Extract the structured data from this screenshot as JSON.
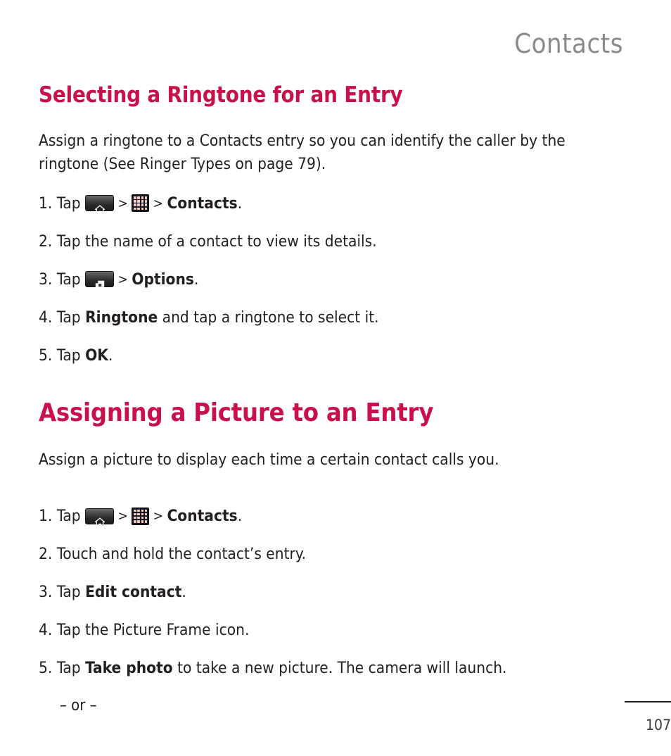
{
  "header": {
    "running_title": "Contacts"
  },
  "sections": [
    {
      "heading": "Selecting a Ringtone for an Entry",
      "intro": "Assign a ringtone to a Contacts entry so you can identify the caller by the ringtone (See Ringer Types on page 79).",
      "steps": [
        {
          "number": "1.",
          "parts": [
            {
              "type": "text",
              "text": "Tap "
            },
            {
              "type": "icon",
              "icon": "home-key-icon"
            },
            {
              "type": "text",
              "text": " > "
            },
            {
              "type": "icon",
              "icon": "app-grid-icon"
            },
            {
              "type": "text",
              "text": " > "
            },
            {
              "type": "bold",
              "text": "Contacts"
            },
            {
              "type": "text",
              "text": "."
            }
          ]
        },
        {
          "number": "2.",
          "parts": [
            {
              "type": "text",
              "text": "Tap the name of a contact to view its details."
            }
          ]
        },
        {
          "number": "3.",
          "parts": [
            {
              "type": "text",
              "text": "Tap "
            },
            {
              "type": "icon",
              "icon": "menu-key-icon"
            },
            {
              "type": "text",
              "text": " > "
            },
            {
              "type": "bold",
              "text": "Options"
            },
            {
              "type": "text",
              "text": "."
            }
          ]
        },
        {
          "number": "4.",
          "parts": [
            {
              "type": "text",
              "text": "Tap "
            },
            {
              "type": "bold",
              "text": "Ringtone"
            },
            {
              "type": "text",
              "text": " and tap a ringtone to select it."
            }
          ]
        },
        {
          "number": "5.",
          "parts": [
            {
              "type": "text",
              "text": "Tap "
            },
            {
              "type": "bold",
              "text": "OK"
            },
            {
              "type": "text",
              "text": "."
            }
          ]
        }
      ]
    },
    {
      "heading": "Assigning a Picture to an Entry",
      "intro": "Assign a picture to display each time a certain contact calls you.",
      "steps": [
        {
          "number": "1.",
          "parts": [
            {
              "type": "text",
              "text": "Tap "
            },
            {
              "type": "icon",
              "icon": "home-key-icon"
            },
            {
              "type": "text",
              "text": " > "
            },
            {
              "type": "icon",
              "icon": "app-grid-icon"
            },
            {
              "type": "text",
              "text": " > "
            },
            {
              "type": "bold",
              "text": "Contacts"
            },
            {
              "type": "text",
              "text": "."
            }
          ]
        },
        {
          "number": "2.",
          "parts": [
            {
              "type": "text",
              "text": "Touch and hold the contact’s entry."
            }
          ]
        },
        {
          "number": "3.",
          "parts": [
            {
              "type": "text",
              "text": "Tap "
            },
            {
              "type": "bold",
              "text": "Edit contact"
            },
            {
              "type": "text",
              "text": "."
            }
          ]
        },
        {
          "number": "4.",
          "parts": [
            {
              "type": "text",
              "text": "Tap the Picture Frame icon."
            }
          ]
        },
        {
          "number": "5.",
          "parts": [
            {
              "type": "text",
              "text": "Tap "
            },
            {
              "type": "bold",
              "text": "Take photo"
            },
            {
              "type": "text",
              "text": " to take a new picture. The camera will launch."
            }
          ]
        }
      ],
      "alternative": "– or –"
    }
  ],
  "footer": {
    "page_number": "107"
  },
  "colors": {
    "heading": "#c8104a",
    "body_text": "#231f20",
    "running_head": "#8a8a8a"
  }
}
